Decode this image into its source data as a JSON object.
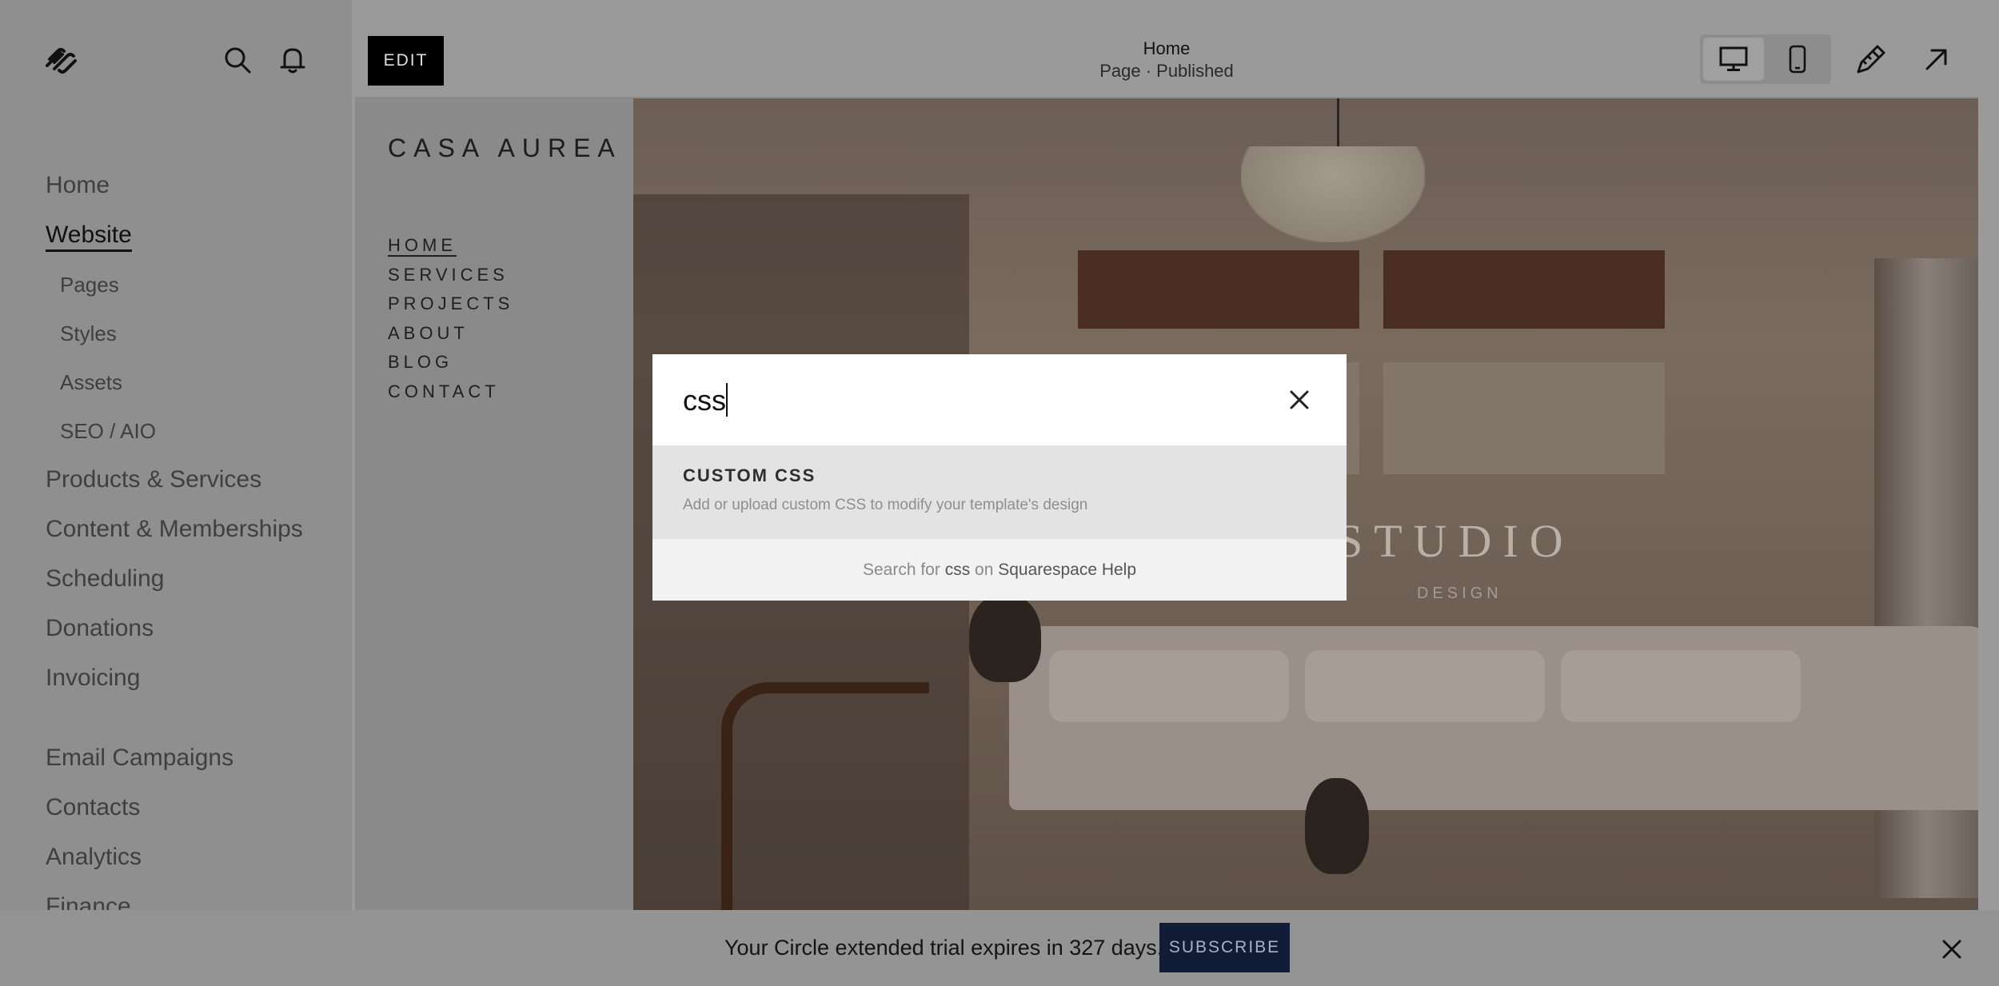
{
  "sidebar": {
    "nav": [
      {
        "label": "Home"
      },
      {
        "label": "Website",
        "active": true
      },
      {
        "label": "Pages",
        "sub": true
      },
      {
        "label": "Styles",
        "sub": true
      },
      {
        "label": "Assets",
        "sub": true
      },
      {
        "label": "SEO / AIO",
        "sub": true
      },
      {
        "label": "Products & Services"
      },
      {
        "label": "Content & Memberships"
      },
      {
        "label": "Scheduling"
      },
      {
        "label": "Donations"
      },
      {
        "label": "Invoicing"
      },
      {
        "label": "Email Campaigns"
      },
      {
        "label": "Contacts"
      },
      {
        "label": "Analytics"
      },
      {
        "label": "Finance"
      }
    ]
  },
  "topbar": {
    "edit_label": "EDIT",
    "page_title": "Home",
    "page_status": "Page · Published"
  },
  "site": {
    "logo": "CASA AUREA",
    "nav": [
      "HOME",
      "SERVICES",
      "PROJECTS",
      "ABOUT",
      "BLOG",
      "CONTACT"
    ],
    "hero_title": "STUDIO",
    "hero_sub": "DESIGN"
  },
  "search": {
    "query": "css",
    "result_title": "CUSTOM CSS",
    "result_desc": "Add or upload custom CSS to modify your template's design",
    "help_prefix": "Search for",
    "help_query": "css",
    "help_mid": "on",
    "help_link": "Squarespace Help"
  },
  "trial": {
    "message": "Your Circle extended trial expires in 327 days.",
    "subscribe_label": "SUBSCRIBE"
  },
  "colors": {
    "subscribe_bg": "#111d36",
    "modal_result_bg": "#e3e3e3"
  }
}
